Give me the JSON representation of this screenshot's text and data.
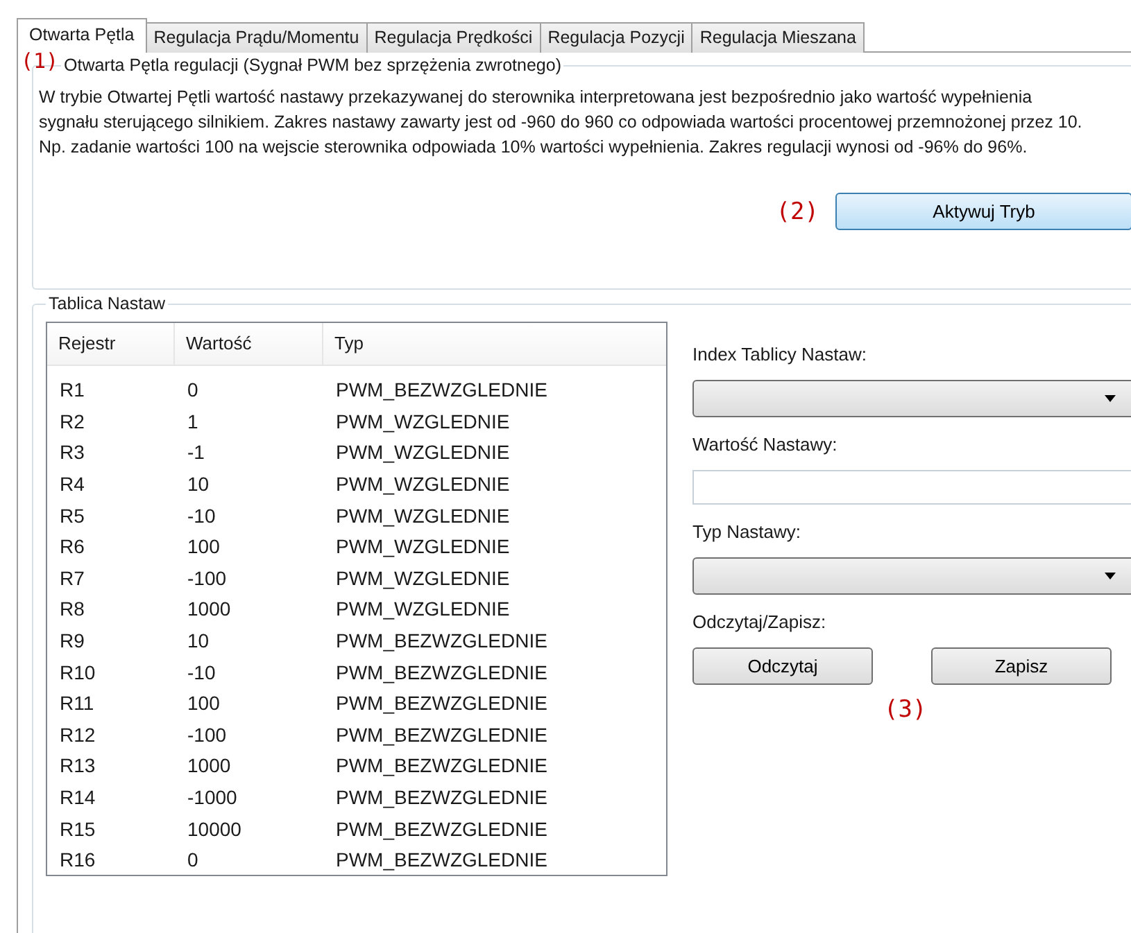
{
  "tabs": [
    {
      "label": "Otwarta Pętla",
      "selected": true
    },
    {
      "label": "Regulacja Prądu/Momentu",
      "selected": false
    },
    {
      "label": "Regulacja Prędkości",
      "selected": false
    },
    {
      "label": "Regulacja Pozycji",
      "selected": false
    },
    {
      "label": "Regulacja Mieszana",
      "selected": false
    }
  ],
  "mode_group": {
    "title": "Otwarta Pętla regulacji (Sygnał PWM bez sprzężenia zwrotnego)",
    "description": "W trybie Otwartej Pętli wartość nastawy przekazywanej do sterownika interpretowana jest bezpośrednio jako wartość wypełnienia sygnału sterującego silnikiem. Zakres nastawy zawarty jest od -960 do 960 co odpowiada wartości procentowej przemnożonej przez  10. Np. zadanie wartości 100 na wejscie sterownika odpowiada 10% wartości wypełnienia. Zakres regulacji wynosi od -96% do 96%.",
    "button": "Aktywuj Tryb"
  },
  "settings_group": {
    "title": "Tablica Nastaw",
    "table": {
      "columns": [
        "Rejestr",
        "Wartość",
        "Typ"
      ],
      "rows": [
        [
          "R1",
          "0",
          "PWM_BEZWZGLEDNIE"
        ],
        [
          "R2",
          "1",
          "PWM_WZGLEDNIE"
        ],
        [
          "R3",
          "-1",
          "PWM_WZGLEDNIE"
        ],
        [
          "R4",
          "10",
          "PWM_WZGLEDNIE"
        ],
        [
          "R5",
          "-10",
          "PWM_WZGLEDNIE"
        ],
        [
          "R6",
          "100",
          "PWM_WZGLEDNIE"
        ],
        [
          "R7",
          "-100",
          "PWM_WZGLEDNIE"
        ],
        [
          "R8",
          "1000",
          "PWM_WZGLEDNIE"
        ],
        [
          "R9",
          "10",
          "PWM_BEZWZGLEDNIE"
        ],
        [
          "R10",
          "-10",
          "PWM_BEZWZGLEDNIE"
        ],
        [
          "R11",
          "100",
          "PWM_BEZWZGLEDNIE"
        ],
        [
          "R12",
          "-100",
          "PWM_BEZWZGLEDNIE"
        ],
        [
          "R13",
          "1000",
          "PWM_BEZWZGLEDNIE"
        ],
        [
          "R14",
          "-1000",
          "PWM_BEZWZGLEDNIE"
        ],
        [
          "R15",
          "10000",
          "PWM_BEZWZGLEDNIE"
        ],
        [
          "R16",
          "0",
          "PWM_BEZWZGLEDNIE"
        ]
      ]
    },
    "form": [
      {
        "kind": "dropdown",
        "label": "Index Tablicy Nastaw:"
      },
      {
        "kind": "input",
        "label": "Wartość Nastawy:"
      },
      {
        "kind": "dropdown",
        "label": "Typ Nastawy:"
      },
      {
        "kind": "buttons",
        "label": "Odczytaj/Zapisz:",
        "buttons": [
          "Odczytaj",
          "Zapisz"
        ]
      }
    ]
  },
  "annotations": [
    "(1)",
    "(2)",
    "(3)"
  ]
}
